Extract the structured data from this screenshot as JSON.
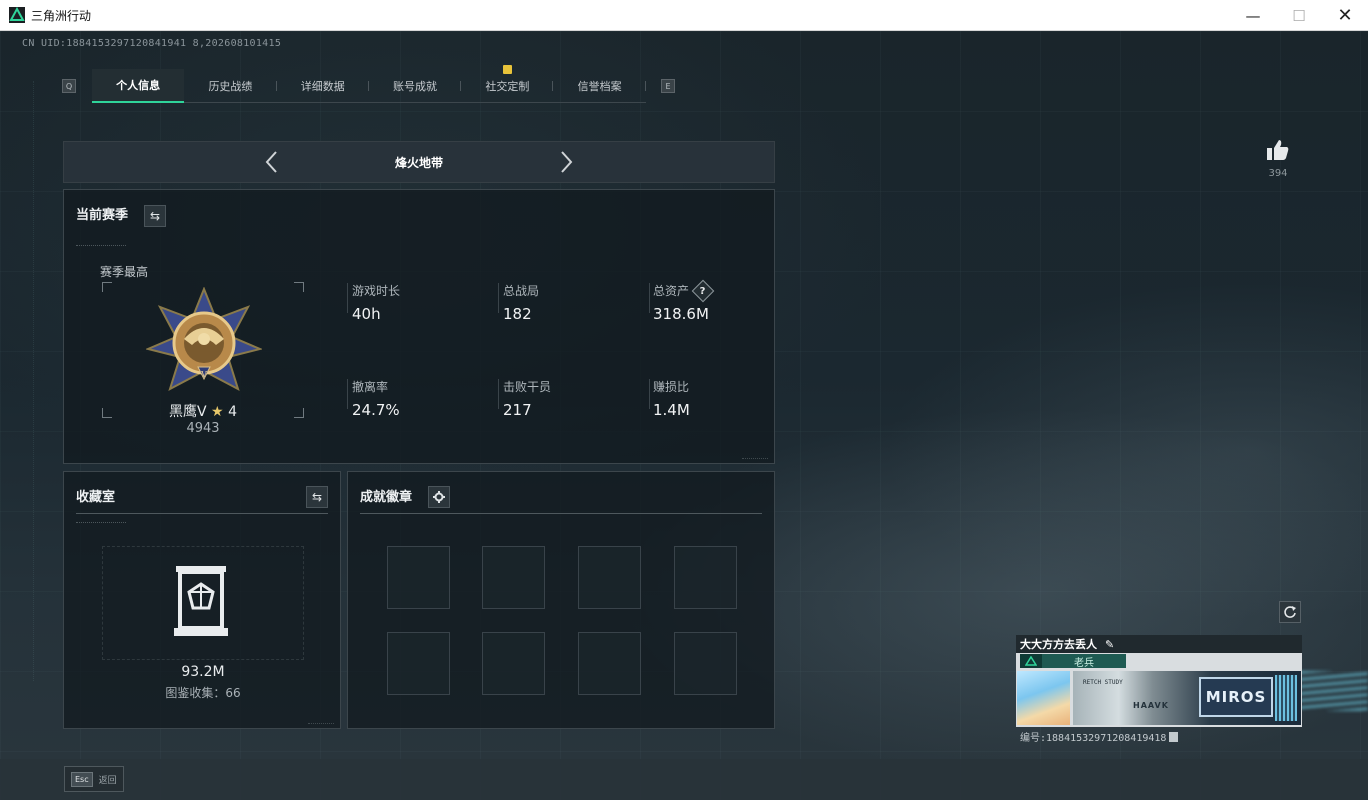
{
  "window": {
    "title": "三角洲行动"
  },
  "uid_line": "CN UID:1884153297120841941 8,202608101415",
  "tabs": {
    "left_key": "Q",
    "right_key": "E",
    "items": [
      {
        "label": "个人信息",
        "active": true
      },
      {
        "label": "历史战绩"
      },
      {
        "label": "详细数据"
      },
      {
        "label": "账号成就"
      },
      {
        "label": "社交定制",
        "badge": true
      },
      {
        "label": "信誉档案"
      }
    ]
  },
  "mode": {
    "title": "烽火地带"
  },
  "season": {
    "title": "当前赛季",
    "best_label": "赛季最高",
    "rank_name": "黑鹰V",
    "rank_stars": "4",
    "rank_score": "4943",
    "stats": [
      {
        "label": "游戏时长",
        "value": "40h"
      },
      {
        "label": "总战局",
        "value": "182"
      },
      {
        "label": "总资产",
        "value": "318.6M",
        "help": true
      },
      {
        "label": "撤离率",
        "value": "24.7%"
      },
      {
        "label": "击败干员",
        "value": "217"
      },
      {
        "label": "赚损比",
        "value": "1.4M"
      }
    ]
  },
  "collection": {
    "title": "收藏室",
    "value": "93.2M",
    "count_text": "图鉴收集：66"
  },
  "badges": {
    "title": "成就徽章"
  },
  "like": {
    "count": "394"
  },
  "player_card": {
    "name": "大大方方去丢人",
    "rank_title": "老兵",
    "banner_small": "RETCH STUDY",
    "banner_name": "HAAVK",
    "banner_logo": "MIROS",
    "uid": "编号:18841532971208419418"
  },
  "esc": {
    "key": "Esc",
    "label": "返回"
  },
  "colors": {
    "accent": "#2fd49a",
    "badge": "#e8c33a",
    "rank_bar": "#1e5a52"
  }
}
